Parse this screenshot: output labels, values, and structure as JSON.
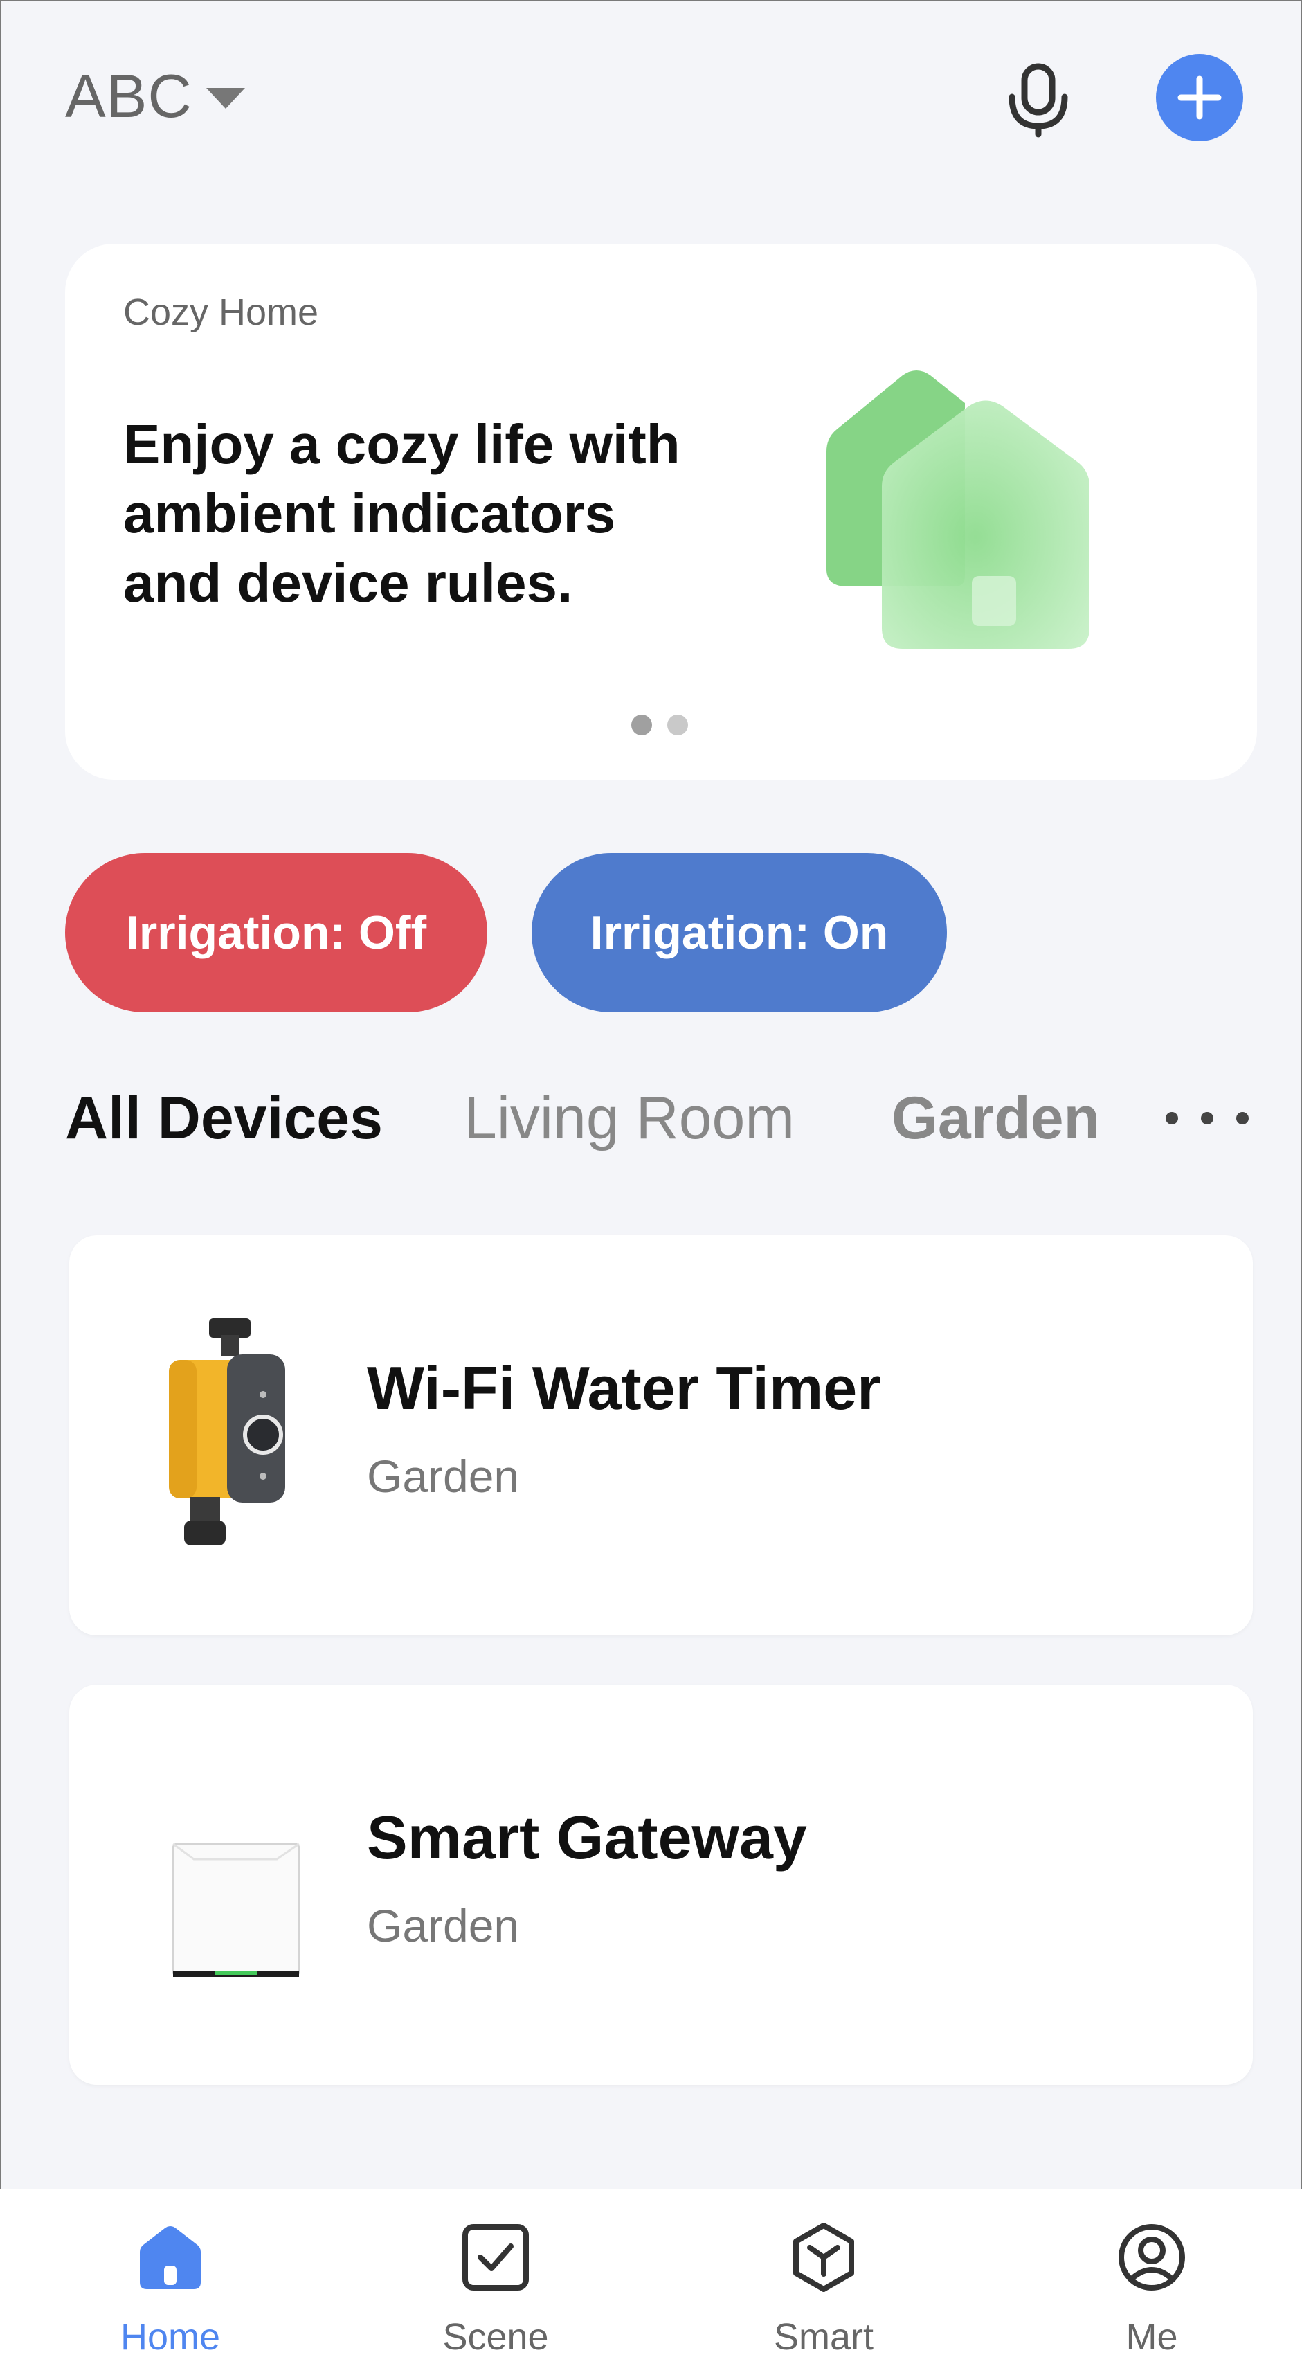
{
  "header": {
    "home_name": "ABC",
    "icons": {
      "mic": "microphone-icon",
      "add": "plus-icon"
    },
    "add_color": "#4f86f0"
  },
  "banner": {
    "subtitle": "Cozy Home",
    "title": "Enjoy a cozy life with ambient indicators and device rules.",
    "page_count": 2,
    "active_page": 1
  },
  "scenes": [
    {
      "label": "Irrigation: Off",
      "color": "#dd4e57"
    },
    {
      "label": "Irrigation: On",
      "color": "#4f7bcd"
    }
  ],
  "room_tabs": {
    "tabs": [
      {
        "label": "All Devices",
        "selected": true
      },
      {
        "label": "Living Room",
        "selected": false
      },
      {
        "label": "Garden",
        "selected": false
      }
    ],
    "more_icon": "more-horizontal-icon"
  },
  "devices": [
    {
      "name": "Wi-Fi Water Timer",
      "room": "Garden",
      "icon": "water-timer-image"
    },
    {
      "name": "Smart Gateway",
      "room": "Garden",
      "icon": "gateway-image"
    }
  ],
  "bottom_nav": [
    {
      "label": "Home",
      "icon": "home-icon",
      "active": true
    },
    {
      "label": "Scene",
      "icon": "checkbox-icon",
      "active": false
    },
    {
      "label": "Smart",
      "icon": "smart-hexagon-icon",
      "active": false
    },
    {
      "label": "Me",
      "icon": "user-circle-icon",
      "active": false
    }
  ],
  "colors": {
    "accent": "#4f86f0",
    "background": "#f4f5f9"
  }
}
